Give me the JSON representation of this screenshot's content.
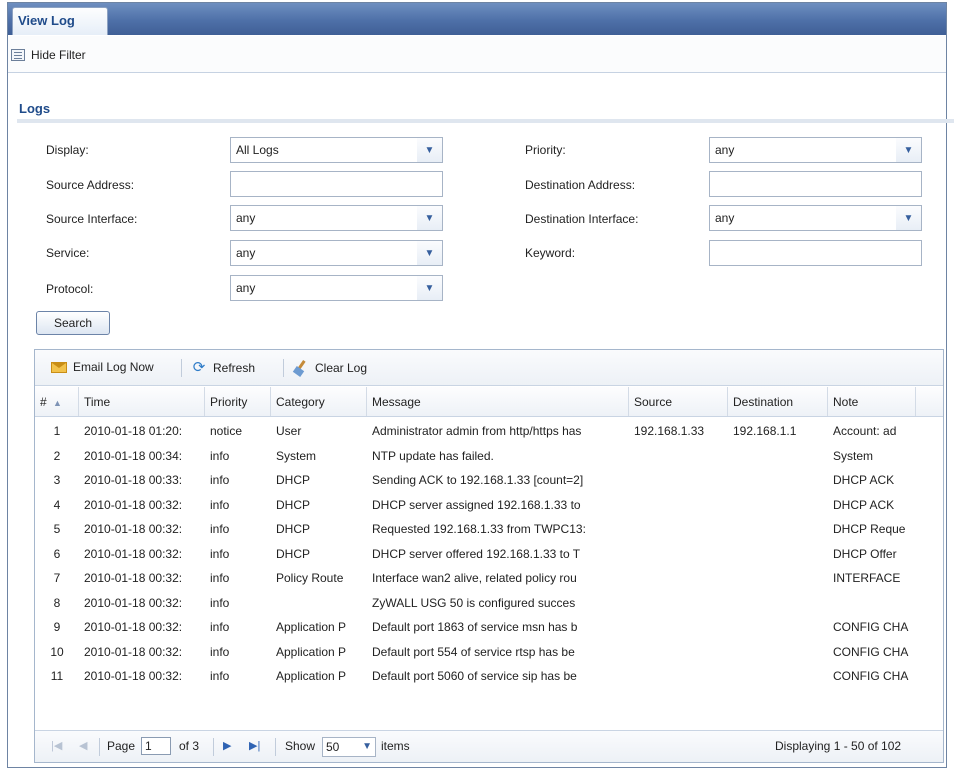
{
  "tab": {
    "label": "View Log"
  },
  "filterbar": {
    "hide_filter_label": "Hide Filter"
  },
  "section": {
    "title": "Logs"
  },
  "filters": {
    "display": {
      "label": "Display:",
      "value": "All Logs"
    },
    "priority": {
      "label": "Priority:",
      "value": "any"
    },
    "source_address": {
      "label": "Source Address:",
      "value": ""
    },
    "destination_address": {
      "label": "Destination Address:",
      "value": ""
    },
    "source_interface": {
      "label": "Source Interface:",
      "value": "any"
    },
    "destination_interface": {
      "label": "Destination Interface:",
      "value": "any"
    },
    "service": {
      "label": "Service:",
      "value": "any"
    },
    "keyword": {
      "label": "Keyword:",
      "value": ""
    },
    "protocol": {
      "label": "Protocol:",
      "value": "any"
    },
    "search_label": "Search"
  },
  "toolbar": {
    "email_label": "Email Log Now",
    "refresh_label": "Refresh",
    "clear_label": "Clear Log"
  },
  "columns": [
    "#",
    "Time",
    "Priority",
    "Category",
    "Message",
    "Source",
    "Destination",
    "Note"
  ],
  "sort_indicator": "▲",
  "rows": [
    [
      "1",
      "2010-01-18 01:20:",
      "notice",
      "User",
      "Administrator admin from http/https has",
      "192.168.1.33",
      "192.168.1.1",
      "Account: ad"
    ],
    [
      "2",
      "2010-01-18 00:34:",
      "info",
      "System",
      "NTP update has failed.",
      "",
      "",
      "System"
    ],
    [
      "3",
      "2010-01-18 00:33:",
      "info",
      "DHCP",
      "Sending ACK to 192.168.1.33 [count=2]",
      "",
      "",
      "DHCP ACK"
    ],
    [
      "4",
      "2010-01-18 00:32:",
      "info",
      "DHCP",
      "DHCP server assigned 192.168.1.33 to",
      "",
      "",
      "DHCP ACK"
    ],
    [
      "5",
      "2010-01-18 00:32:",
      "info",
      "DHCP",
      "Requested 192.168.1.33 from TWPC13:",
      "",
      "",
      "DHCP Reque"
    ],
    [
      "6",
      "2010-01-18 00:32:",
      "info",
      "DHCP",
      "DHCP server offered 192.168.1.33 to T",
      "",
      "",
      "DHCP Offer"
    ],
    [
      "7",
      "2010-01-18 00:32:",
      "info",
      "Policy Route",
      "Interface wan2 alive, related policy rou",
      "",
      "",
      "INTERFACE"
    ],
    [
      "8",
      "2010-01-18 00:32:",
      "info",
      "",
      "ZyWALL USG 50 is configured succes",
      "",
      "",
      ""
    ],
    [
      "9",
      "2010-01-18 00:32:",
      "info",
      "Application P",
      "Default port 1863 of service msn has b",
      "",
      "",
      "CONFIG CHA"
    ],
    [
      "10",
      "2010-01-18 00:32:",
      "info",
      "Application P",
      "Default port 554 of service rtsp has be",
      "",
      "",
      "CONFIG CHA"
    ],
    [
      "11",
      "2010-01-18 00:32:",
      "info",
      "Application P",
      "Default port 5060 of service sip has be",
      "",
      "",
      "CONFIG CHA"
    ]
  ],
  "pager": {
    "page_label": "Page",
    "page_value": "1",
    "of_label": "of 3",
    "show_label": "Show",
    "show_value": "50",
    "items_label": "items",
    "displaying": "Displaying 1 - 50 of 102"
  },
  "colors": {
    "accent": "#1f4b8a",
    "tabbar": "#4e70a8"
  }
}
